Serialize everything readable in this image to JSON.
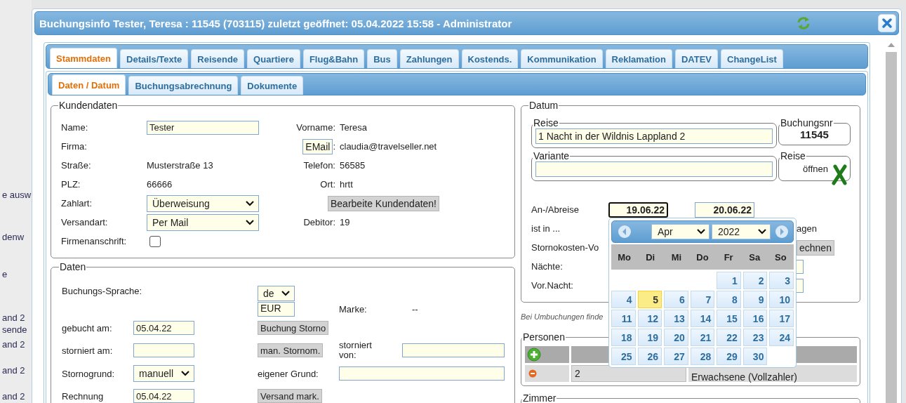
{
  "background_page": {
    "fragments": [
      "e ausw",
      "denw",
      "e",
      "and 2",
      "sende",
      "and 2",
      "and 2",
      "and 2"
    ]
  },
  "window": {
    "title": "Buchungsinfo Tester, Teresa : 11545 (703115) zuletzt geöffnet: 05.04.2022 15:58 - Administrator"
  },
  "main_tabs": [
    {
      "label": "Stammdaten",
      "selected": true
    },
    {
      "label": "Details/Texte",
      "selected": false
    },
    {
      "label": "Reisende",
      "selected": false
    },
    {
      "label": "Quartiere",
      "selected": false
    },
    {
      "label": "Flug&Bahn",
      "selected": false
    },
    {
      "label": "Bus",
      "selected": false
    },
    {
      "label": "Zahlungen",
      "selected": false
    },
    {
      "label": "Kostends.",
      "selected": false
    },
    {
      "label": "Kommunikation",
      "selected": false
    },
    {
      "label": "Reklamation",
      "selected": false
    },
    {
      "label": "DATEV",
      "selected": false
    },
    {
      "label": "ChangeList",
      "selected": false
    }
  ],
  "sub_tabs": [
    {
      "label": "Daten / Datum",
      "selected": true
    },
    {
      "label": "Buchungsabrechnung",
      "selected": false
    },
    {
      "label": "Dokumente",
      "selected": false
    }
  ],
  "kundendaten": {
    "legend": "Kundendaten",
    "name": {
      "label": "Name:",
      "value": "Tester"
    },
    "firma": {
      "label": "Firma:"
    },
    "strasse": {
      "label": "Straße:",
      "value": "Musterstraße 13"
    },
    "plz": {
      "label": "PLZ:",
      "value": "66666"
    },
    "zahlart": {
      "label": "Zahlart:",
      "value": "Überweisung"
    },
    "versandart": {
      "label": "Versandart:",
      "value": "Per Mail"
    },
    "firmenanschrift": {
      "label": "Firmenanschrift:",
      "checked": false
    },
    "vorname": {
      "label": "Vorname:",
      "value": "Teresa"
    },
    "email": {
      "button": "EMail",
      "separator": ":",
      "value": "claudia@travelseller.net"
    },
    "telefon": {
      "label": "Telefon:",
      "value": "56585"
    },
    "ort": {
      "label": "Ort:",
      "value": "hrtt"
    },
    "edit_button": "Bearbeite Kundendaten!",
    "debitor": {
      "label": "Debitor:",
      "value": "19"
    }
  },
  "daten": {
    "legend": "Daten",
    "sprache": {
      "label": "Buchungs-Sprache:",
      "value": "de",
      "currency": "EUR"
    },
    "marke": {
      "label": "Marke:",
      "value": "--"
    },
    "gebucht_am": {
      "label": "gebucht am:",
      "value": "05.04.22",
      "button": "Buchung Storno"
    },
    "storniert_am": {
      "label": "storniert am:",
      "button": "man. Stornom."
    },
    "storniert_von": {
      "label": "storniert von:"
    },
    "stornogrund": {
      "label": "Stornogrund:",
      "value": "manuell"
    },
    "eigener_grund": {
      "label": "eigener Grund:"
    },
    "rechnung_versandt": {
      "label": "Rechnung",
      "value": "05.04.22",
      "button": "Versand mark."
    }
  },
  "datum": {
    "legend": "Datum",
    "reise": {
      "legend": "Reise",
      "value": "1 Nacht in der Wildnis Lappland 2"
    },
    "buchungsnr": {
      "legend": "Buchungsnr",
      "value": "11545"
    },
    "variante": {
      "legend": "Variante"
    },
    "reise_oeffnen": {
      "legend": "Reise",
      "label": "öffnen"
    },
    "an_abreise": {
      "label": "An-/Abreise",
      "arrival": {
        "value": "19.06.22",
        "focused": true
      },
      "departure": {
        "value": "20.06.22",
        "focused": false
      }
    },
    "rows": [
      {
        "label": "ist in ...",
        "kind": "text",
        "trailing": "agen"
      },
      {
        "label": "Stornokosten-Vo",
        "kind": "button",
        "trailing": "echnen"
      },
      {
        "label": "Nächte:",
        "kind": "field"
      },
      {
        "label": "Vor.Nacht:",
        "kind": "field"
      }
    ]
  },
  "note": "Bei Umbuchungen finde",
  "personen": {
    "legend": "Personen",
    "rows": [
      {
        "count": "2",
        "type": "Erwachsene (Vollzahler)"
      }
    ]
  },
  "zimmer": {
    "legend": "Zimmer"
  },
  "calendar": {
    "month": "Apr",
    "year": "2022",
    "weekdays": [
      "Mo",
      "Di",
      "Mi",
      "Do",
      "Fr",
      "Sa",
      "So"
    ],
    "weeks": [
      [
        {
          "kind": "blank"
        },
        {
          "kind": "blank"
        },
        {
          "kind": "blank"
        },
        {
          "kind": "blank"
        },
        {
          "kind": "day",
          "day": "1",
          "today": false
        },
        {
          "kind": "day",
          "day": "2",
          "today": false
        },
        {
          "kind": "day",
          "day": "3",
          "today": false
        }
      ],
      [
        {
          "kind": "day",
          "day": "4",
          "today": false
        },
        {
          "kind": "day",
          "day": "5",
          "today": true
        },
        {
          "kind": "day",
          "day": "6",
          "today": false
        },
        {
          "kind": "day",
          "day": "7",
          "today": false
        },
        {
          "kind": "day",
          "day": "8",
          "today": false
        },
        {
          "kind": "day",
          "day": "9",
          "today": false
        },
        {
          "kind": "day",
          "day": "10",
          "today": false
        }
      ],
      [
        {
          "kind": "day",
          "day": "11",
          "today": false
        },
        {
          "kind": "day",
          "day": "12",
          "today": false
        },
        {
          "kind": "day",
          "day": "13",
          "today": false
        },
        {
          "kind": "day",
          "day": "14",
          "today": false
        },
        {
          "kind": "day",
          "day": "15",
          "today": false
        },
        {
          "kind": "day",
          "day": "16",
          "today": false
        },
        {
          "kind": "day",
          "day": "17",
          "today": false
        }
      ],
      [
        {
          "kind": "day",
          "day": "18",
          "today": false
        },
        {
          "kind": "day",
          "day": "19",
          "today": false
        },
        {
          "kind": "day",
          "day": "20",
          "today": false
        },
        {
          "kind": "day",
          "day": "21",
          "today": false
        },
        {
          "kind": "day",
          "day": "22",
          "today": false
        },
        {
          "kind": "day",
          "day": "23",
          "today": false
        },
        {
          "kind": "day",
          "day": "24",
          "today": false
        }
      ],
      [
        {
          "kind": "day",
          "day": "25",
          "today": false
        },
        {
          "kind": "day",
          "day": "26",
          "today": false
        },
        {
          "kind": "day",
          "day": "27",
          "today": false
        },
        {
          "kind": "day",
          "day": "28",
          "today": false
        },
        {
          "kind": "day",
          "day": "29",
          "today": false
        },
        {
          "kind": "day",
          "day": "30",
          "today": false
        },
        {
          "kind": "blank"
        }
      ]
    ]
  }
}
